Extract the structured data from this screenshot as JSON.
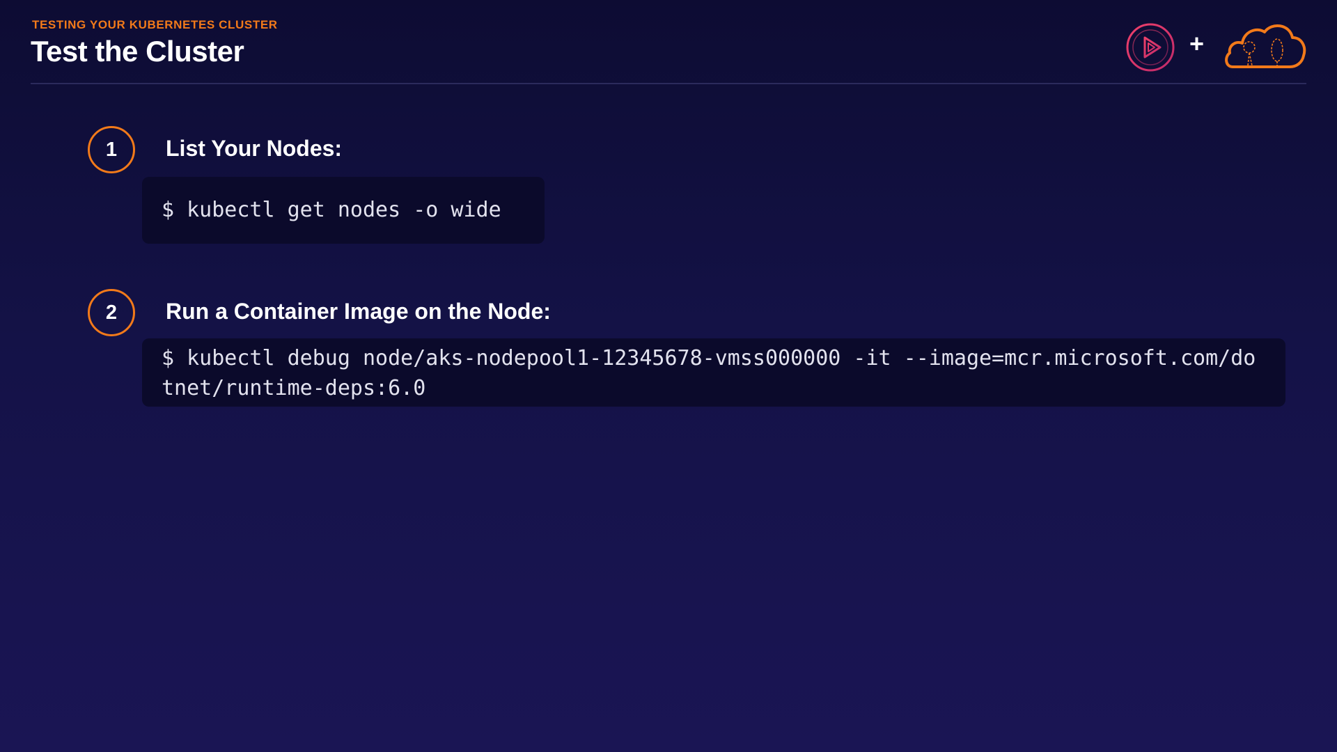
{
  "header": {
    "eyebrow": "TESTING YOUR KUBERNETES CLUSTER",
    "title": "Test the Cluster",
    "plus": "+"
  },
  "logos": {
    "left_icon": "play-circle-icon",
    "right_icon": "cloud-icon",
    "accent_color": "#f27a1a",
    "play_color": "#e0305a"
  },
  "steps": [
    {
      "number": "1",
      "title": "List Your Nodes:",
      "command": "$ kubectl get nodes -o wide"
    },
    {
      "number": "2",
      "title": "Run a Container Image on the Node:",
      "command": "$ kubectl debug node/aks-nodepool1-12345678-vmss000000 -it --image=mcr.microsoft.com/dotnet/runtime-deps:6.0"
    }
  ]
}
